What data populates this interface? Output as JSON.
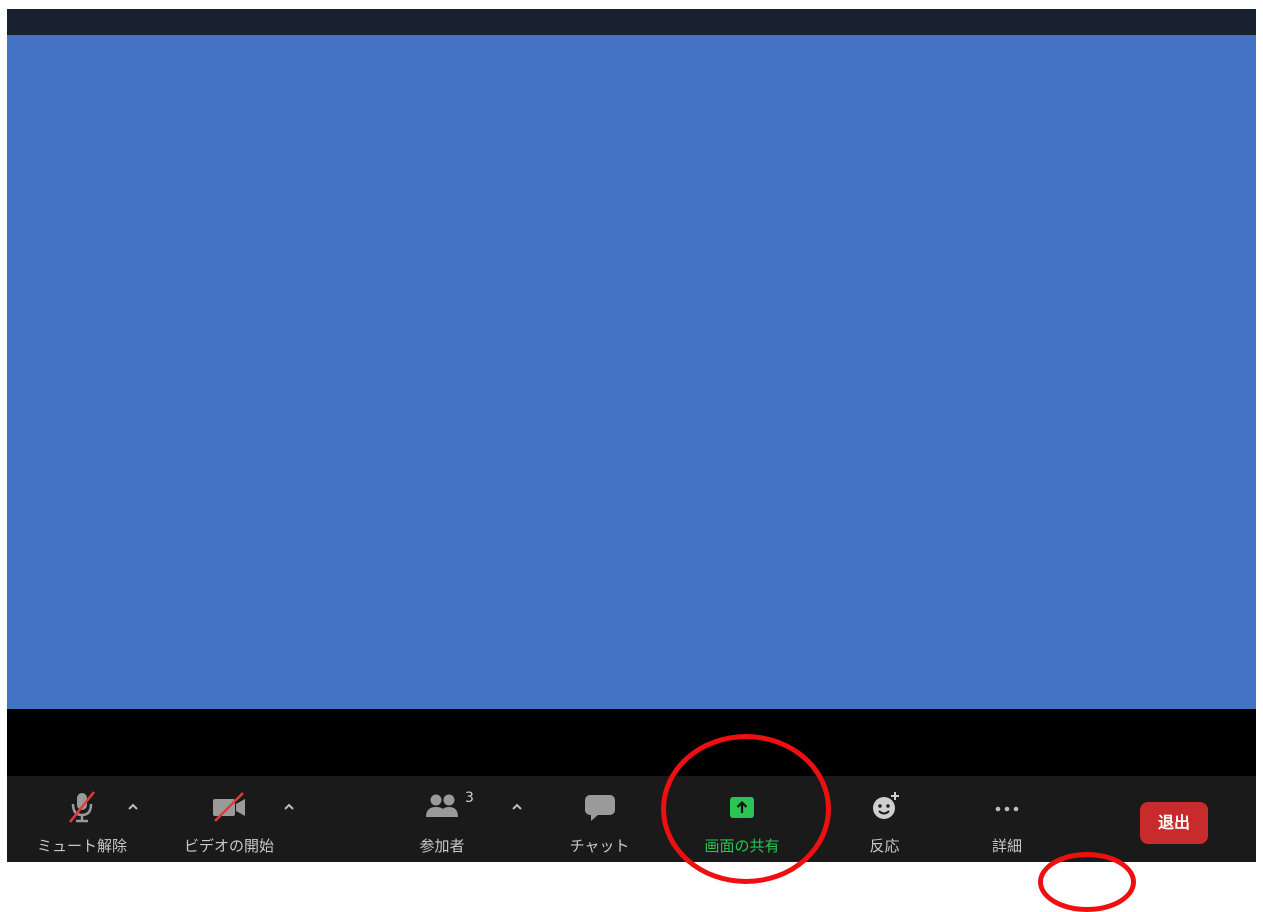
{
  "toolbar": {
    "mute": {
      "label": "ミュート解除",
      "icon": "microphone-muted-icon"
    },
    "video": {
      "label": "ビデオの開始",
      "icon": "video-off-icon"
    },
    "participants": {
      "label": "参加者",
      "count": "3",
      "icon": "participants-icon"
    },
    "chat": {
      "label": "チャット",
      "icon": "chat-icon"
    },
    "share": {
      "label": "画面の共有",
      "icon": "share-screen-icon"
    },
    "reactions": {
      "label": "反応",
      "icon": "reaction-icon"
    },
    "more": {
      "label": "詳細",
      "icon": "more-icon"
    },
    "leave": {
      "label": "退出"
    }
  },
  "colors": {
    "video_background": "#4472c4",
    "toolbar_background": "#1a1a1a",
    "share_accent": "#29c553",
    "leave_button": "#c72b2b",
    "annotation_circle": "#ee1010"
  }
}
